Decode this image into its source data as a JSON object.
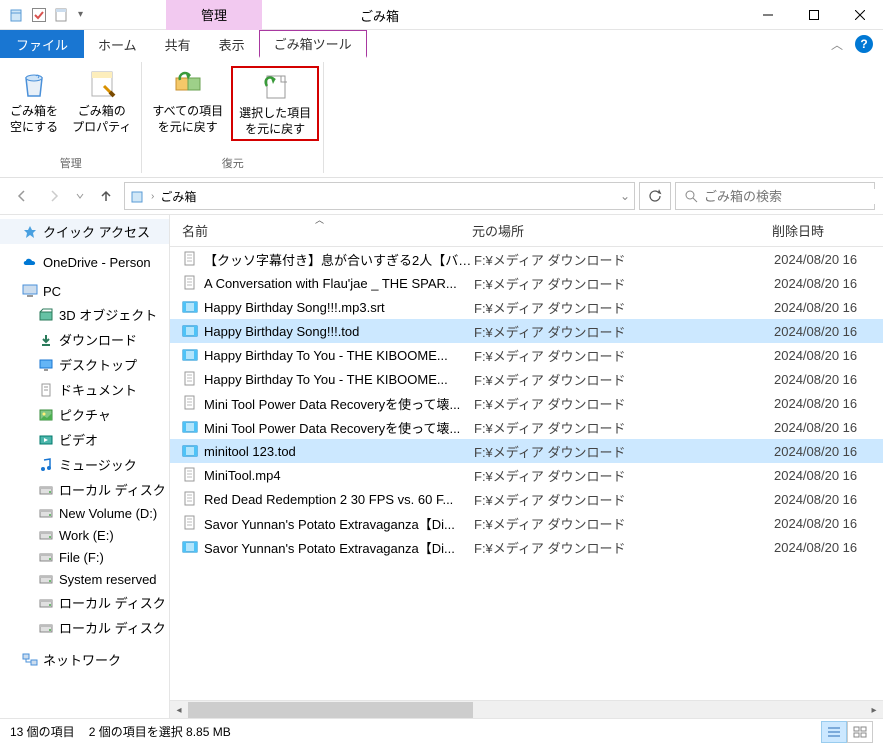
{
  "window": {
    "contextual_tab": "管理",
    "title": "ごみ箱"
  },
  "tabs": {
    "file": "ファイル",
    "home": "ホーム",
    "share": "共有",
    "view": "表示",
    "recycle_tools": "ごみ箱ツール"
  },
  "ribbon": {
    "group_manage": "管理",
    "group_restore": "復元",
    "empty_bin_l1": "ごみ箱を",
    "empty_bin_l2": "空にする",
    "props_l1": "ごみ箱の",
    "props_l2": "プロパティ",
    "restore_all_l1": "すべての項目",
    "restore_all_l2": "を元に戻す",
    "restore_sel_l1": "選択した項目",
    "restore_sel_l2": "を元に戻す"
  },
  "address": {
    "path": "ごみ箱"
  },
  "search": {
    "placeholder": "ごみ箱の検索"
  },
  "columns": {
    "name": "名前",
    "orig_location": "元の場所",
    "del_date": "削除日時"
  },
  "sidebar": {
    "quick_access": "クイック アクセス",
    "onedrive": "OneDrive - Person",
    "pc": "PC",
    "pc_children": [
      "3D オブジェクト",
      "ダウンロード",
      "デスクトップ",
      "ドキュメント",
      "ピクチャ",
      "ビデオ",
      "ミュージック",
      "ローカル ディスク (C",
      "New Volume (D:)",
      "Work (E:)",
      "File (F:)",
      "System reserved",
      "ローカル ディスク (H",
      "ローカル ディスク (I:)"
    ],
    "network": "ネットワーク"
  },
  "files": [
    {
      "name": "【クッソ字幕付き】息が合いすぎる2人【バニ...",
      "loc": "F:¥メディア ダウンロード",
      "date": "2024/08/20 16",
      "type": "txt",
      "selected": false
    },
    {
      "name": "A Conversation with Flau'jae _ THE SPAR...",
      "loc": "F:¥メディア ダウンロード",
      "date": "2024/08/20 16",
      "type": "txt",
      "selected": false
    },
    {
      "name": "Happy Birthday Song!!!.mp3.srt",
      "loc": "F:¥メディア ダウンロード",
      "date": "2024/08/20 16",
      "type": "vid",
      "selected": false
    },
    {
      "name": "Happy Birthday Song!!!.tod",
      "loc": "F:¥メディア ダウンロード",
      "date": "2024/08/20 16",
      "type": "vid",
      "selected": true
    },
    {
      "name": "Happy Birthday To You - THE KIBOOME...",
      "loc": "F:¥メディア ダウンロード",
      "date": "2024/08/20 16",
      "type": "vid",
      "selected": false
    },
    {
      "name": "Happy Birthday To You - THE KIBOOME...",
      "loc": "F:¥メディア ダウンロード",
      "date": "2024/08/20 16",
      "type": "txt",
      "selected": false
    },
    {
      "name": "Mini Tool Power Data Recoveryを使って壊...",
      "loc": "F:¥メディア ダウンロード",
      "date": "2024/08/20 16",
      "type": "txt",
      "selected": false
    },
    {
      "name": "Mini Tool Power Data Recoveryを使って壊...",
      "loc": "F:¥メディア ダウンロード",
      "date": "2024/08/20 16",
      "type": "vid",
      "selected": false
    },
    {
      "name": "minitool 123.tod",
      "loc": "F:¥メディア ダウンロード",
      "date": "2024/08/20 16",
      "type": "vid",
      "selected": true
    },
    {
      "name": "MiniTool.mp4",
      "loc": "F:¥メディア ダウンロード",
      "date": "2024/08/20 16",
      "type": "txt",
      "selected": false
    },
    {
      "name": "Red Dead Redemption 2 30 FPS vs. 60 F...",
      "loc": "F:¥メディア ダウンロード",
      "date": "2024/08/20 16",
      "type": "txt",
      "selected": false
    },
    {
      "name": "Savor Yunnan's Potato Extravaganza【Di...",
      "loc": "F:¥メディア ダウンロード",
      "date": "2024/08/20 16",
      "type": "txt",
      "selected": false
    },
    {
      "name": "Savor Yunnan's Potato Extravaganza【Di...",
      "loc": "F:¥メディア ダウンロード",
      "date": "2024/08/20 16",
      "type": "vid",
      "selected": false
    }
  ],
  "status": {
    "count": "13 個の項目",
    "selection": "2 個の項目を選択 8.85 MB"
  }
}
